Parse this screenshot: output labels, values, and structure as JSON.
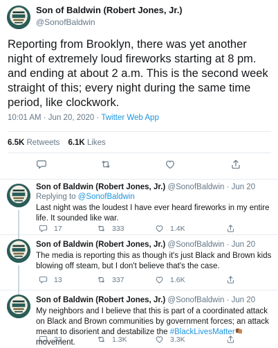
{
  "main_tweet": {
    "author_name": "Son of Baldwin (Robert Jones, Jr.)",
    "author_handle": "@SonofBaldwin",
    "text": "Reporting from Brooklyn, there was yet another night of extremely loud fireworks starting at 8 pm. and ending at about 2 a.m. This is the second week straight of this; every night during the same time period, like clockwork.",
    "timestamp": "10:01 AM · Jun 20, 2020 · ",
    "source": "Twitter Web App",
    "retweets_count": "6.5K",
    "retweets_label": "Retweets",
    "likes_count": "6.1K",
    "likes_label": "Likes"
  },
  "replies": [
    {
      "author_name": "Son of Baldwin (Robert Jones, Jr.)",
      "author_handle": "@SonofBaldwin · Jun 20",
      "replying_prefix": "Replying to ",
      "replying_to": "@SonofBaldwin",
      "text": "Last night was the loudest I have ever heard fireworks in my entire life. It sounded like war.",
      "reply_count": "17",
      "retweet_count": "333",
      "like_count": "1.4K"
    },
    {
      "author_name": "Son of Baldwin (Robert Jones, Jr.)",
      "author_handle": "@SonofBaldwin · Jun 20",
      "text": "The media is reporting this as though it's just Black and Brown kids blowing off steam, but I don't believe that's the case.",
      "reply_count": "13",
      "retweet_count": "337",
      "like_count": "1.6K"
    },
    {
      "author_name": "Son of Baldwin (Robert Jones, Jr.)",
      "author_handle": "@SonofBaldwin · Jun 20",
      "text_before": "My neighbors and I believe that this is part of a coordinated attack on Black and Brown communities by government forces; an attack meant to disorient and destabilize the ",
      "hashtag": "#BlackLivesMatter",
      "text_after": " movement.",
      "reply_count": "33",
      "retweet_count": "1.3K",
      "like_count": "3.3K"
    }
  ],
  "avatar_text": "SON OF BALDWIN",
  "colors": {
    "link": "#1b95e0",
    "secondary_text": "#657786",
    "divider": "#e6ecf0",
    "avatar_bg": "#2a5c58"
  },
  "icons": [
    "comment-icon",
    "retweet-icon",
    "like-icon",
    "share-icon"
  ]
}
